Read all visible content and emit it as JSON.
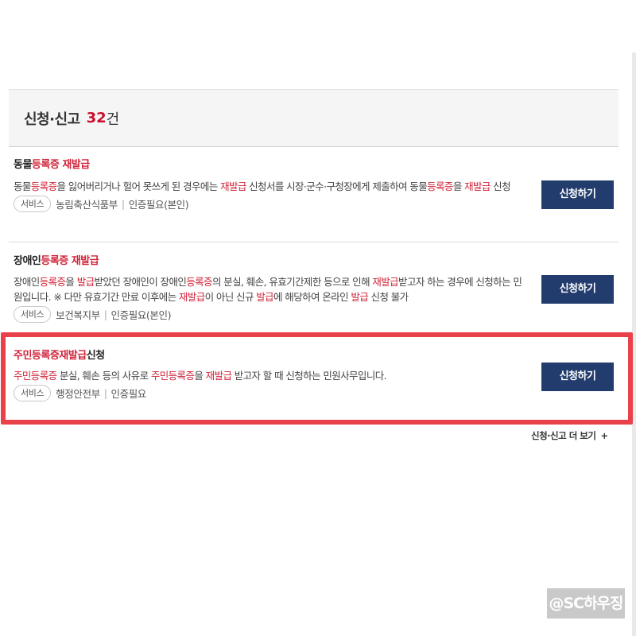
{
  "header": {
    "title": "신청·신고",
    "count": "32",
    "unit": "건"
  },
  "items": [
    {
      "title": [
        {
          "t": "동물",
          "hl": false
        },
        {
          "t": "등록증",
          "hl": true
        },
        {
          "t": " ",
          "hl": false
        },
        {
          "t": "재발급",
          "hl": true
        }
      ],
      "desc": [
        {
          "t": "동물",
          "hl": false
        },
        {
          "t": "등록증",
          "hl": true
        },
        {
          "t": "을 잃어버리거나 헐어 못쓰게 된 경우에는 ",
          "hl": false
        },
        {
          "t": "재발급",
          "hl": true
        },
        {
          "t": " 신청서를 시장·군수·구청장에게 제출하여 동물",
          "hl": false
        },
        {
          "t": "등록증",
          "hl": true
        },
        {
          "t": "을 ",
          "hl": false
        },
        {
          "t": "재발급",
          "hl": true
        },
        {
          "t": " 신청",
          "hl": false
        }
      ],
      "tag": "서비스",
      "dept": "농림축산식품부",
      "auth": "인증필요(본인)",
      "button": "신청하기"
    },
    {
      "title": [
        {
          "t": "장애인",
          "hl": false
        },
        {
          "t": "등록증",
          "hl": true
        },
        {
          "t": " ",
          "hl": false
        },
        {
          "t": "재발급",
          "hl": true
        }
      ],
      "desc": [
        {
          "t": "장애인",
          "hl": false
        },
        {
          "t": "등록증",
          "hl": true
        },
        {
          "t": "을 ",
          "hl": false
        },
        {
          "t": "발급",
          "hl": true
        },
        {
          "t": "받았던 장애인이 장애인",
          "hl": false
        },
        {
          "t": "등록증",
          "hl": true
        },
        {
          "t": "의 분실, 훼손, 유효기간제한 등으로 인해 ",
          "hl": false
        },
        {
          "t": "재발급",
          "hl": true
        },
        {
          "t": "받고자 하는 경우에 신청하는 민원입니다. ※ 다만 유효기간 만료 이후에는 ",
          "hl": false
        },
        {
          "t": "재발급",
          "hl": true
        },
        {
          "t": "이 아닌 신규 ",
          "hl": false
        },
        {
          "t": "발급",
          "hl": true
        },
        {
          "t": "에 해당하여 온라인 ",
          "hl": false
        },
        {
          "t": "발급",
          "hl": true
        },
        {
          "t": " 신청 불가",
          "hl": false
        }
      ],
      "tag": "서비스",
      "dept": "보건복지부",
      "auth": "인증필요(본인)",
      "button": "신청하기"
    },
    {
      "title": [
        {
          "t": "주민등록증재발급",
          "hl": true
        },
        {
          "t": "신청",
          "hl": false
        }
      ],
      "desc": [
        {
          "t": "주민등록증",
          "hl": true
        },
        {
          "t": " 분실, 훼손 등의 사유로 ",
          "hl": false
        },
        {
          "t": "주민등록증",
          "hl": true
        },
        {
          "t": "을 ",
          "hl": false
        },
        {
          "t": "재발급",
          "hl": true
        },
        {
          "t": " 받고자 할 때 신청하는 민원사무입니다.",
          "hl": false
        }
      ],
      "tag": "서비스",
      "dept": "행정안전부",
      "auth": "인증필요",
      "button": "신청하기"
    }
  ],
  "more": {
    "label": "신청·신고 더 보기",
    "icon": "plus-icon",
    "glyph": "+"
  },
  "watermark": "@SC하우징",
  "colors": {
    "highlight_text": "#d0253a",
    "button_bg": "#233c6e",
    "frame": "#e8414a"
  }
}
